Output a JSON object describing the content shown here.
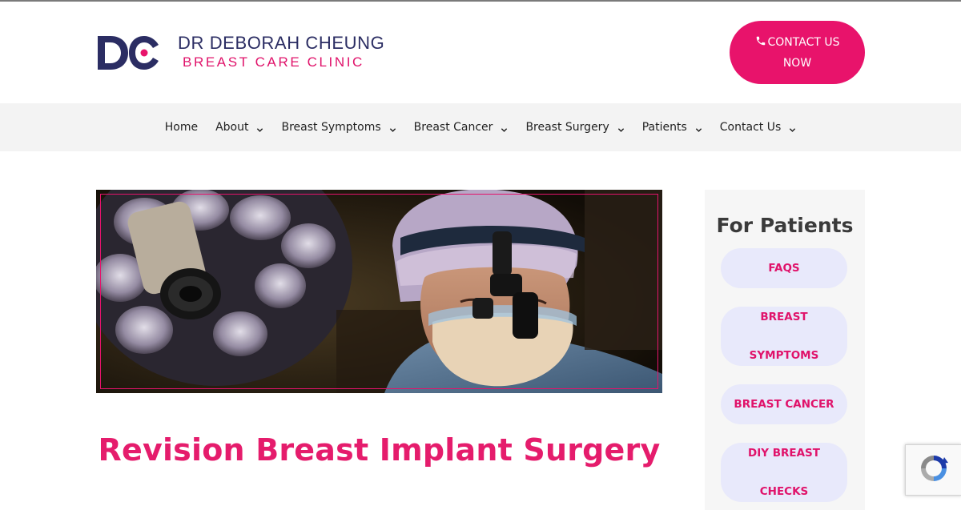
{
  "logo": {
    "monogram": "DC",
    "line1": "DR DEBORAH CHEUNG",
    "line2": "BREAST CARE CLINIC"
  },
  "header": {
    "contact_button": {
      "line1": "CONTACT US",
      "line2": "NOW",
      "icon": "phone-icon"
    }
  },
  "nav": {
    "items": [
      {
        "label": "Home",
        "has_dropdown": false
      },
      {
        "label": "About",
        "has_dropdown": true
      },
      {
        "label": "Breast Symptoms",
        "has_dropdown": true
      },
      {
        "label": "Breast Cancer",
        "has_dropdown": true
      },
      {
        "label": "Breast Surgery",
        "has_dropdown": true
      },
      {
        "label": "Patients",
        "has_dropdown": true
      },
      {
        "label": "Contact Us",
        "has_dropdown": true
      }
    ]
  },
  "main": {
    "hero_image": "surgeon with headlamp and surgical light",
    "title": "Revision Breast Implant Surgery"
  },
  "sidebar": {
    "title": "For Patients",
    "buttons": [
      {
        "line1": "FAQS",
        "line2": ""
      },
      {
        "line1": "BREAST",
        "line2": "SYMPTOMS"
      },
      {
        "line1": "BREAST CANCER",
        "line2": ""
      },
      {
        "line1": "DIY BREAST",
        "line2": "CHECKS"
      }
    ]
  },
  "colors": {
    "brand_pink": "#e8136b",
    "brand_navy": "#2b2d63",
    "nav_bg": "#f3f3f3",
    "sidebar_button_bg": "#e8e9fb"
  },
  "recaptcha": {
    "icon": "recaptcha-icon"
  }
}
